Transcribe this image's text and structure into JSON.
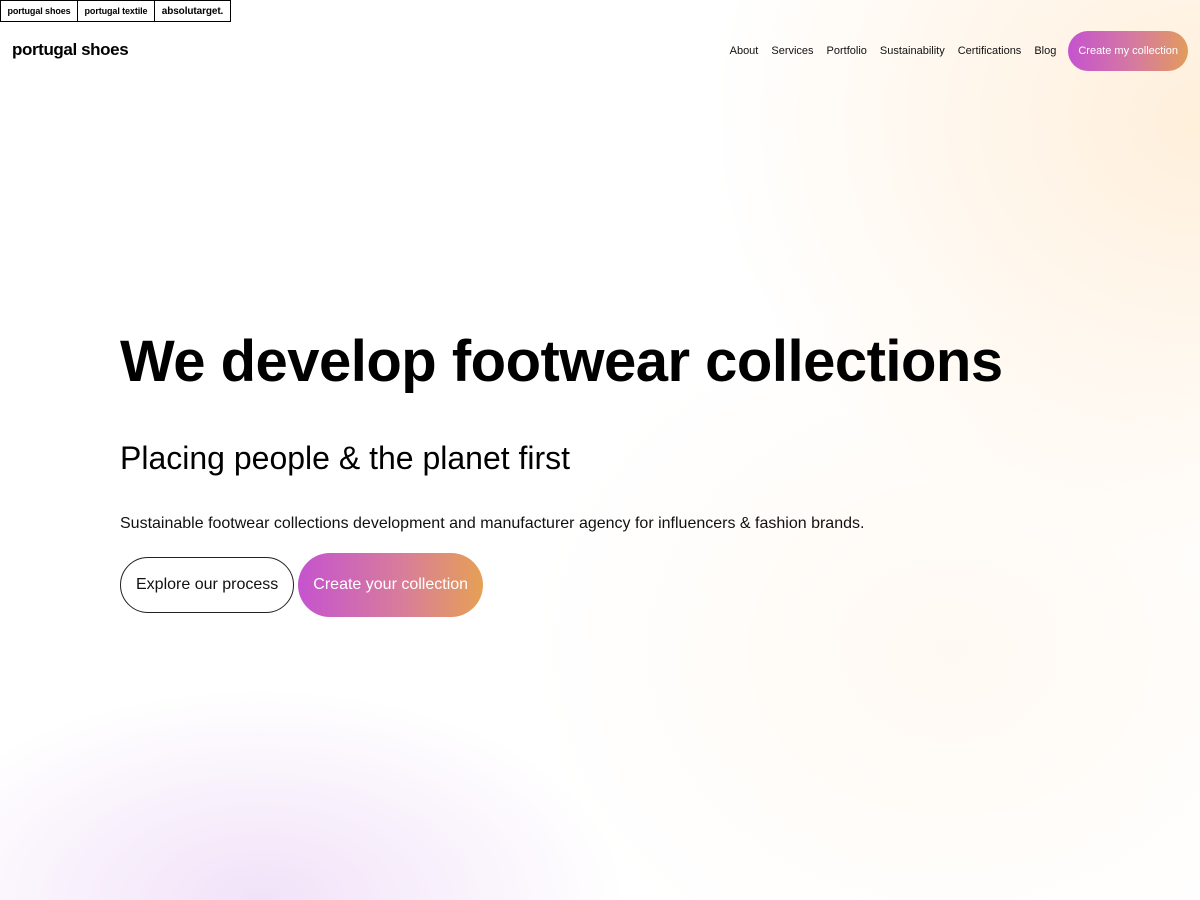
{
  "brand_strip": {
    "tabs": [
      "portugal shoes",
      "portugal textile",
      "absolutarget."
    ]
  },
  "header": {
    "logo": "portugal shoes",
    "nav": [
      "About",
      "Services",
      "Portfolio",
      "Sustainability",
      "Certifications",
      "Blog"
    ],
    "cta": "Create my collection"
  },
  "hero": {
    "title": "We develop footwear collections",
    "subtitle": "Placing people & the planet first",
    "description": "Sustainable footwear collections development and manufacturer agency for influencers & fashion brands.",
    "primary_button": "Explore our process",
    "secondary_button": "Create your collection"
  },
  "colors": {
    "gradient_start": "#c553cf",
    "gradient_end": "#e39b5c",
    "text": "#000000"
  }
}
